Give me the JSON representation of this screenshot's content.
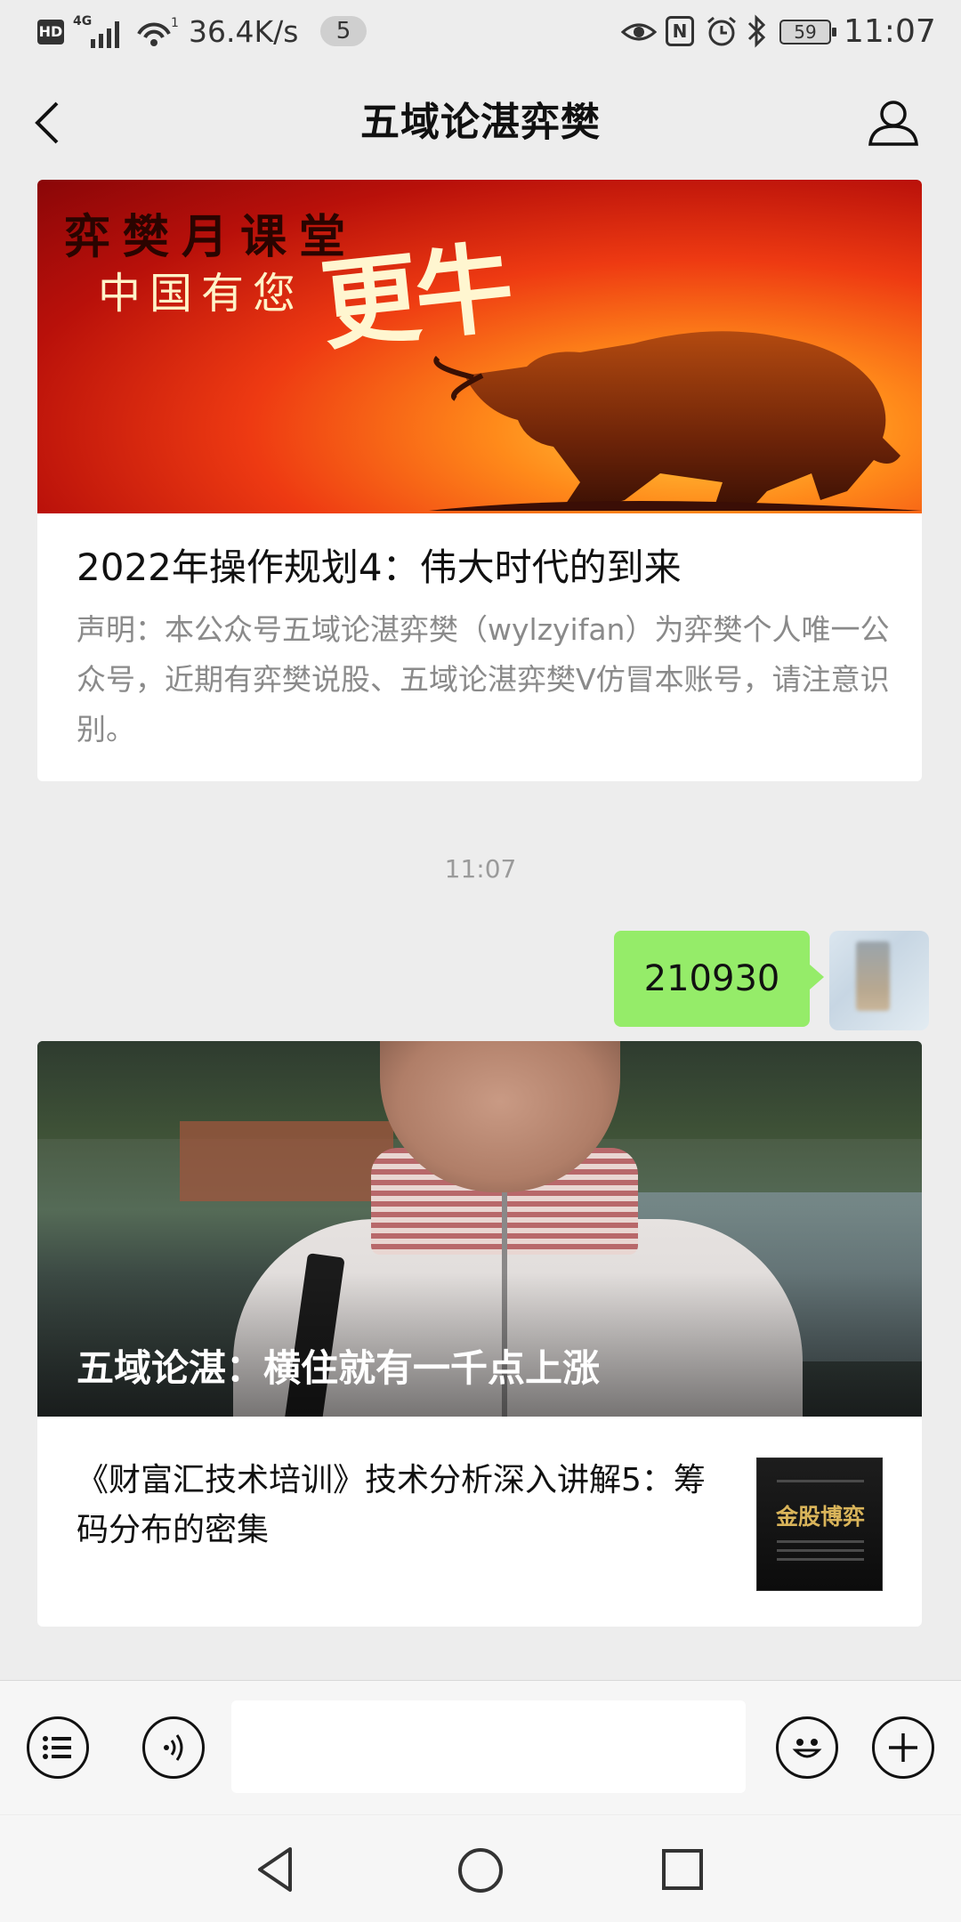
{
  "status_bar": {
    "network": "4G",
    "speed": "36.4K/s",
    "notif_count": "5",
    "battery": "59",
    "time": "11:07",
    "icons": [
      "hd-icon",
      "signal-icon",
      "wifi-icon",
      "eye-icon",
      "nfc-icon",
      "alarm-icon",
      "bluetooth-icon",
      "battery-icon"
    ]
  },
  "nav": {
    "title": "五域论湛弈樊",
    "back_icon": "back-arrow-icon",
    "profile_icon": "person-icon"
  },
  "article1": {
    "banner_line1": "弈樊月课堂",
    "banner_line2": "中国有您",
    "banner_line3": "更牛",
    "title": "2022年操作规划4：伟大时代的到来",
    "description": "声明：本公众号五域论湛弈樊（wylzyifan）为弈樊个人唯一公众号，近期有弈樊说股、五域论湛弈樊V仿冒本账号，请注意识别。"
  },
  "timestamp": "11:07",
  "message": {
    "text": "210930"
  },
  "article2": {
    "photo_title": "五域论湛：横住就有一千点上涨",
    "item_title": "《财富汇技术培训》技术分析深入讲解5：筹码分布的密集",
    "thumb_text": "金股博弈"
  },
  "input_bar": {
    "menu_icon": "list-menu-icon",
    "voice_icon": "voice-icon",
    "emoji_icon": "emoji-icon",
    "plus_icon": "plus-icon",
    "text_value": ""
  },
  "system_nav": {
    "icons": [
      "back-triangle-icon",
      "home-circle-icon",
      "recents-square-icon"
    ]
  },
  "colors": {
    "bubble": "#95ec69",
    "background": "#ededed"
  }
}
